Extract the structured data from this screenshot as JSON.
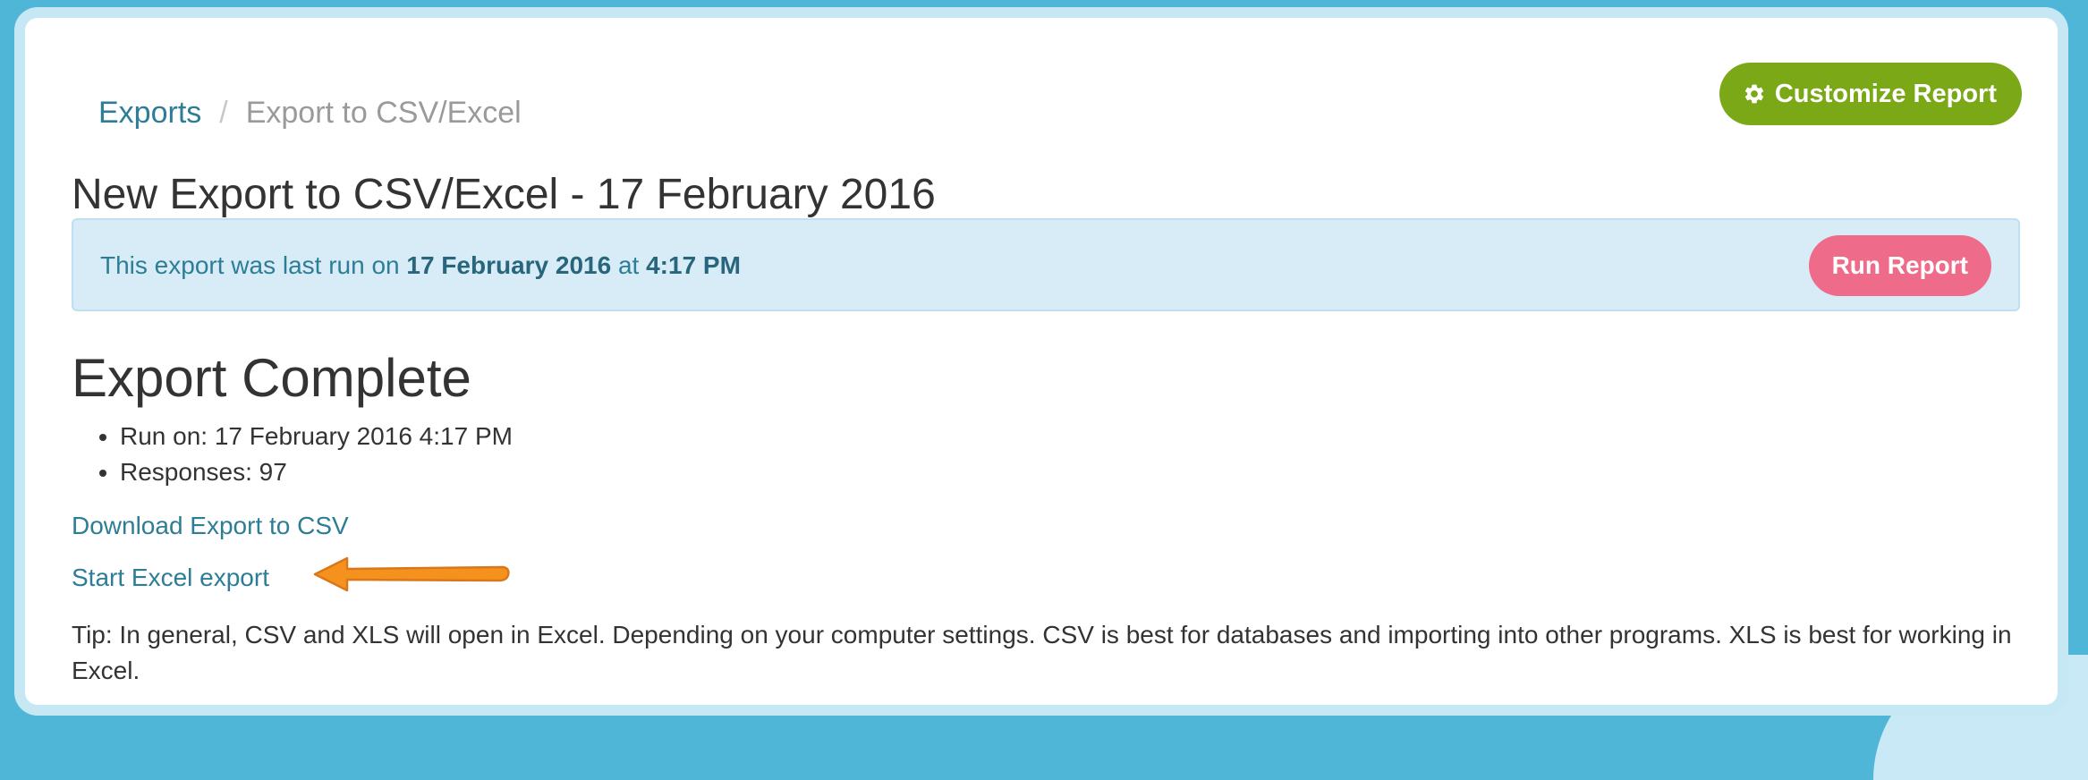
{
  "breadcrumb": {
    "parent_label": "Exports",
    "separator": "/",
    "current_label": "Export to CSV/Excel"
  },
  "header": {
    "customize_button_label": "Customize Report",
    "customize_button_icon": "gear-icon",
    "title": "New Export to CSV/Excel - 17 February 2016"
  },
  "alert": {
    "prefix": "This export was last run on",
    "date": "17 February 2016",
    "at_word": "at",
    "time": "4:17 PM",
    "run_button_label": "Run Report"
  },
  "export_status": {
    "heading": "Export Complete",
    "details": [
      {
        "label": "Run on:",
        "value": "17 February 2016 4:17 PM"
      },
      {
        "label": "Responses:",
        "value": "97"
      }
    ]
  },
  "links": {
    "download_csv": "Download Export to CSV",
    "start_excel": "Start Excel export"
  },
  "tip": "Tip: In general, CSV and XLS will open in Excel. Depending on your computer settings. CSV is best for databases and importing into other programs. XLS is best for working in Excel.",
  "colors": {
    "page_background": "#4fb6d8",
    "link": "#2e7d96",
    "customize_button": "#7aa817",
    "run_button": "#ee6b8a",
    "alert_background": "#d8ecf7",
    "annotation_arrow": "#f5921e"
  }
}
